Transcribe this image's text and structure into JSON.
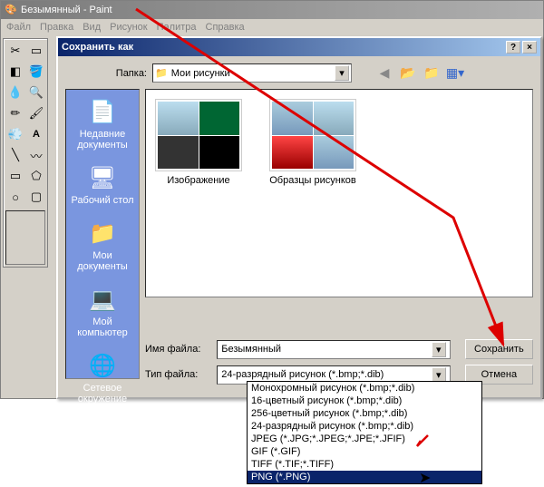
{
  "titlebar": {
    "text": "Безымянный - Paint"
  },
  "menubar": [
    "Файл",
    "Правка",
    "Вид",
    "Рисунок",
    "Палитра",
    "Справка"
  ],
  "tools": [
    "▱",
    "☆",
    "✎",
    "▲",
    "🖊",
    "⌂",
    "✏",
    "▭",
    "💨",
    "🔍",
    "✎",
    "🖌",
    "A",
    "╱",
    "〰",
    "▭",
    "⬠",
    "○",
    "◢",
    "◣"
  ],
  "dialog": {
    "title": "Сохранить как",
    "help_btn": "?",
    "close_btn": "×",
    "folder_label": "Папка:",
    "folder_value": "Мои рисунки",
    "places": [
      {
        "icon": "📄",
        "label": "Недавние документы"
      },
      {
        "icon": "🖥",
        "label": "Рабочий стол"
      },
      {
        "icon": "📁",
        "label": "Мои документы"
      },
      {
        "icon": "💻",
        "label": "Мой компьютер"
      },
      {
        "icon": "🌐",
        "label": "Сетевое окружение"
      }
    ],
    "thumbs": [
      {
        "label": "Изображение"
      },
      {
        "label": "Образцы рисунков"
      }
    ],
    "filename_label": "Имя файла:",
    "filename_value": "Безымянный",
    "filetype_label": "Тип файла:",
    "filetype_value": "24-разрядный рисунок (*.bmp;*.dib)",
    "save_btn": "Сохранить",
    "cancel_btn": "Отмена",
    "filetype_options": [
      "Монохромный рисунок (*.bmp;*.dib)",
      "16-цветный рисунок (*.bmp;*.dib)",
      "256-цветный рисунок (*.bmp;*.dib)",
      "24-разрядный рисунок (*.bmp;*.dib)",
      "JPEG (*.JPG;*.JPEG;*.JPE;*.JFIF)",
      "GIF (*.GIF)",
      "TIFF (*.TIF;*.TIFF)",
      "PNG (*.PNG)"
    ],
    "filetype_selected_index": 7
  }
}
